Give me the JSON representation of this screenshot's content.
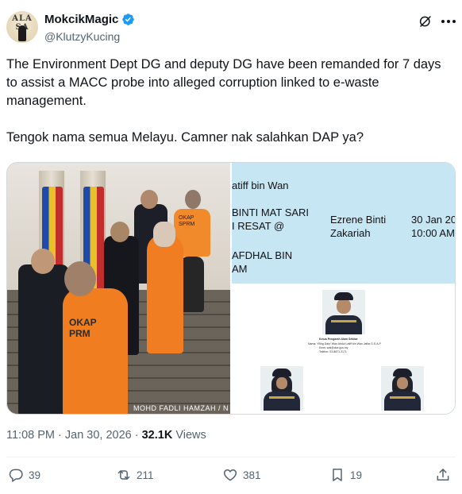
{
  "author": {
    "display_name": "MokcikMagic",
    "handle": "@KlutzyKucing",
    "avatar_monogram": "ALA SA"
  },
  "tweet": {
    "paragraph1": "The Environment Dept DG and deputy DG have been remanded for 7 days to assist a MACC probe into alleged corruption linked to e-waste management.",
    "paragraph2": "Tengok nama semua Melayu. Camner nak salahkan DAP ya?"
  },
  "media": {
    "photo_caption": "MOHD FADLI HAMZAH / N",
    "left_shirt_text_front": "OKAP\nPRM",
    "left_shirt_text_back": "OKAP\nSPRM",
    "document": {
      "row1_col1": "atiff bin Wan",
      "row2_col1_line1": "BINTI MAT SARI",
      "row2_col1_line2": "I RESAT @",
      "row3_col1_line1": "AFDHAL BIN",
      "row3_col1_line2": "AM",
      "row2_col2_line1": "Ezrene Binti",
      "row2_col2_line2": "Zakariah",
      "row2_col3_line1": "30 Jan 20",
      "row2_col3_line2": "10:00 AM",
      "officer_caption_title": "Ketua Pengarah Alam Sekitar",
      "officer_caption_line2": "Nama: YBhg Dato' Wan Abdul Latiff bin Wan Jaffar D.S.A.P",
      "officer_caption_line3": "Emel: wal@doe.gov.my",
      "officer_caption_line4": "Telefon: 03-8871 2171"
    }
  },
  "meta": {
    "timestamp": "11:08 PM · Jan 30, 2026 · ",
    "views_count": "32.1K",
    "views_label": " Views"
  },
  "actions": {
    "replies": "39",
    "reposts": "211",
    "likes": "381",
    "bookmarks": "19"
  },
  "colors": {
    "text_primary": "#0f1419",
    "text_secondary": "#536471",
    "verified_blue": "#1d9bf0",
    "divider": "#eff3f4"
  },
  "icons": [
    "verified-badge-icon",
    "grok-icon",
    "more-options-icon",
    "reply-icon",
    "repost-icon",
    "like-icon",
    "bookmark-icon",
    "share-icon"
  ]
}
